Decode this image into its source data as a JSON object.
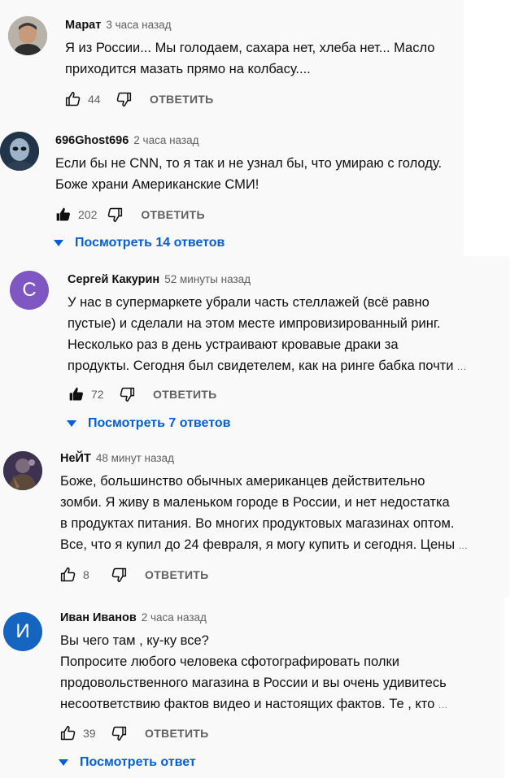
{
  "ui": {
    "reply_label": "ОТВЕТИТЬ"
  },
  "comments": [
    {
      "author": "Марат",
      "time": "3 часа назад",
      "avatar_letter": "",
      "lines": [
        "Я из России... Мы голодаем, сахара нет, хлеба нет... Масло",
        "приходится мазать прямо на колбасу...."
      ],
      "truncated": false,
      "likes": "44",
      "liked": false,
      "view_replies": ""
    },
    {
      "author": "696Ghost696",
      "time": "2 часа назад",
      "avatar_letter": "",
      "lines": [
        "Если бы не CNN, то я так и не узнал бы, что умираю с голоду.",
        "Боже храни Американские СМИ!"
      ],
      "truncated": false,
      "likes": "202",
      "liked": true,
      "view_replies": "Посмотреть 14 ответов"
    },
    {
      "author": "Сергей Какурин",
      "time": "52 минуты назад",
      "avatar_letter": "С",
      "avatar_color": "#7e57c2",
      "lines": [
        "У нас в супермаркете убрали часть стеллажей (всё равно",
        "пустые) и сделали на этом месте импровизированный ринг.",
        "Несколько раз в день устраивают кровавые драки за",
        "продукты. Сегодня был свидетелем, как на ринге бабка почти"
      ],
      "truncated": true,
      "likes": "72",
      "liked": true,
      "view_replies": "Посмотреть 7 ответов"
    },
    {
      "author": "НеЙТ",
      "time": "48 минут назад",
      "avatar_letter": "",
      "lines": [
        "Боже, большинство обычных американцев действительно",
        "зомби. Я живу в маленьком городе в России, и нет недостатка",
        "в продуктах питания. Во многих продуктовых магазинах оптом.",
        "Все, что я купил до 24 февраля, я могу купить и сегодня. Цены"
      ],
      "truncated": true,
      "likes": "8",
      "liked": false,
      "view_replies": ""
    },
    {
      "author": "Иван Иванов",
      "time": "2 часа назад",
      "avatar_letter": "И",
      "avatar_color": "#1565c0",
      "lines": [
        "Вы чего там , ку-ку все?",
        "Попросите любого человека сфотографировать полки",
        "продовольственного магазина в России и вы очень удивитесь",
        "несоответствию фактов видео и настоящих фактов. Те , кто"
      ],
      "truncated": true,
      "likes": "39",
      "liked": false,
      "view_replies": "Посмотреть ответ"
    }
  ]
}
